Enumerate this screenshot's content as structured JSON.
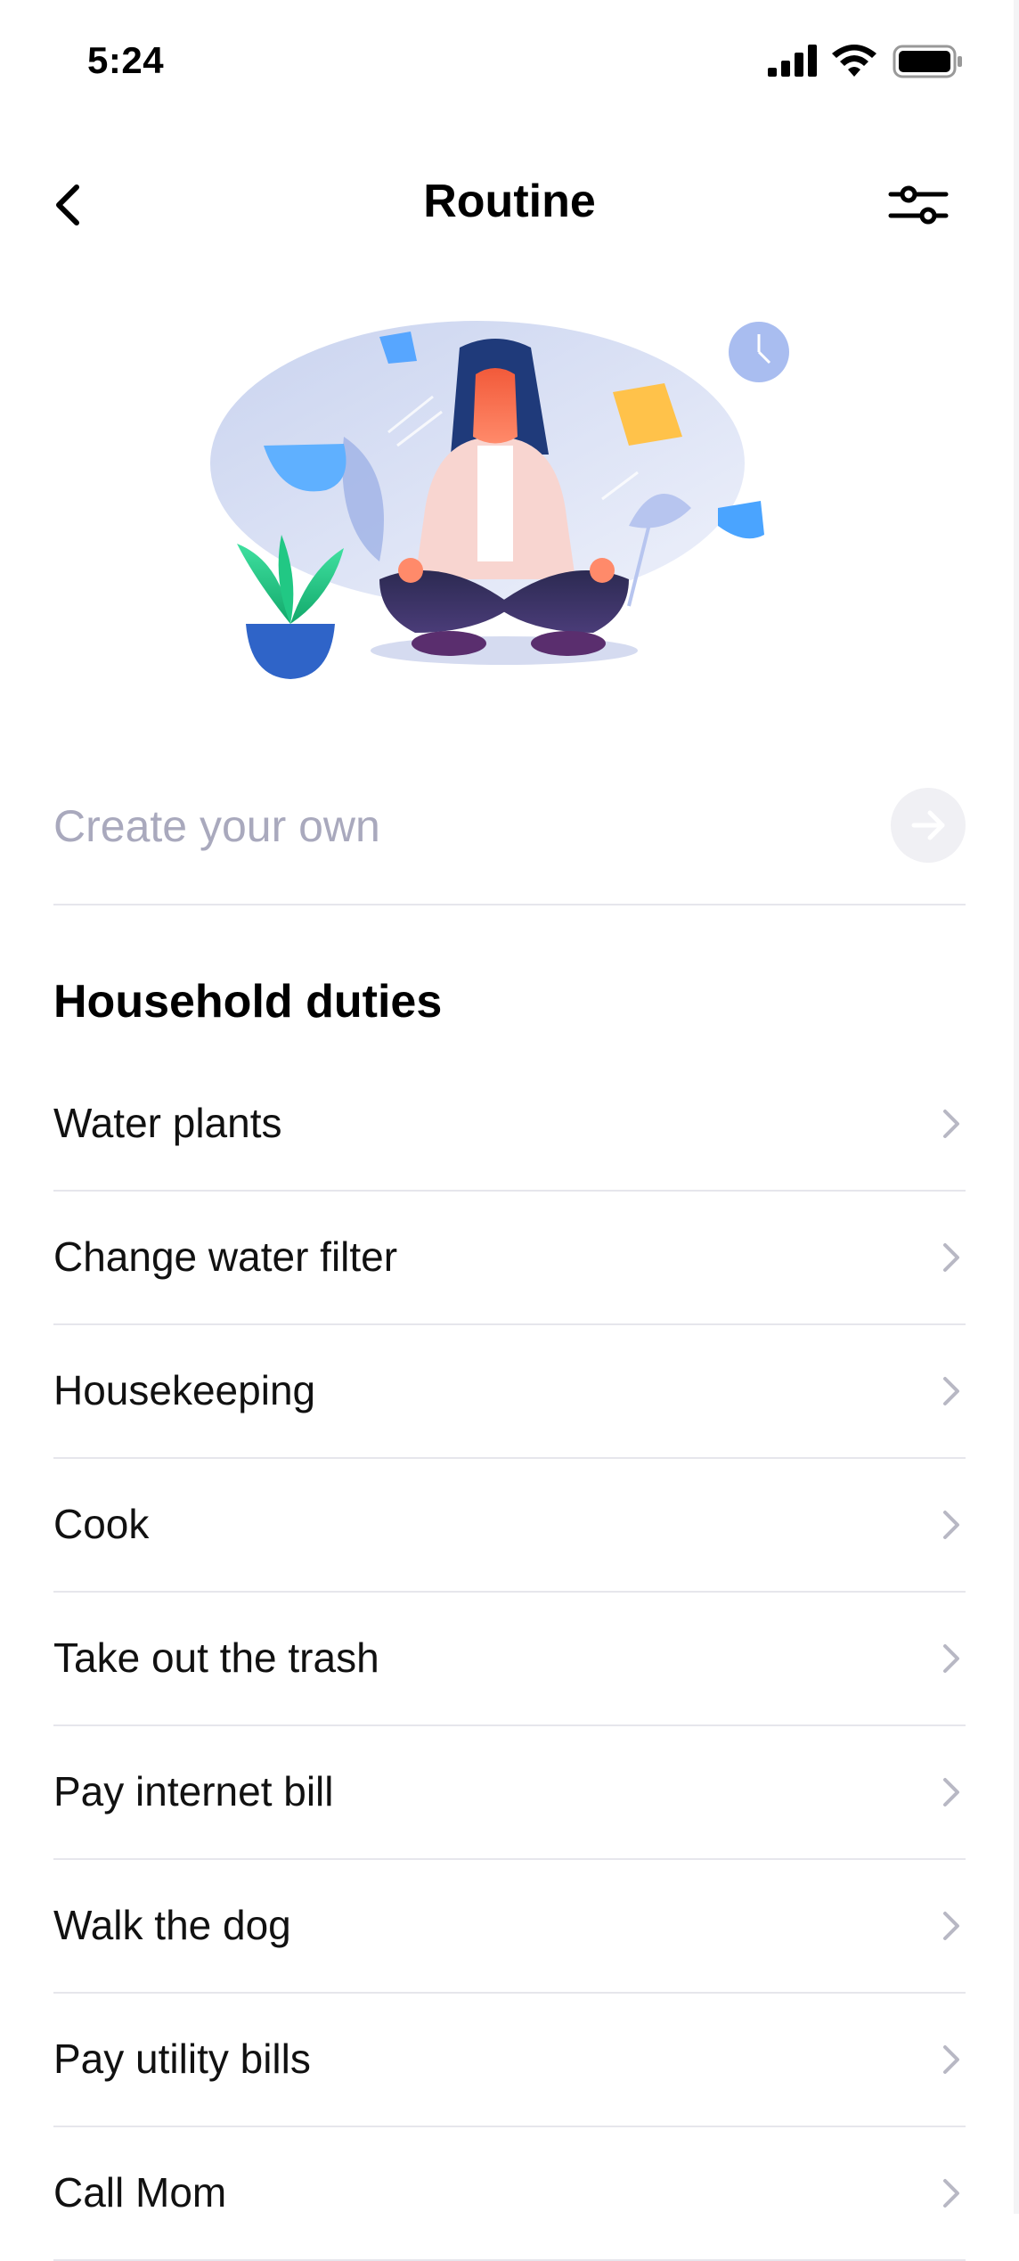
{
  "status_bar": {
    "time": "5:24",
    "icons": [
      "cellular-signal-icon",
      "wifi-icon",
      "battery-icon"
    ]
  },
  "nav": {
    "title": "Routine",
    "back_icon": "chevron-left-icon",
    "filter_icon": "sliders-icon"
  },
  "hero": {
    "illustration": "meditating-woman-illustration"
  },
  "create": {
    "placeholder": "Create your own",
    "button_icon": "arrow-right-icon"
  },
  "section": {
    "title": "Household duties",
    "items": [
      {
        "label": "Water plants"
      },
      {
        "label": "Change water filter"
      },
      {
        "label": "Housekeeping"
      },
      {
        "label": "Cook"
      },
      {
        "label": "Take out the trash"
      },
      {
        "label": "Pay internet bill"
      },
      {
        "label": "Walk the dog"
      },
      {
        "label": "Pay utility bills"
      },
      {
        "label": "Call Mom"
      }
    ]
  },
  "colors": {
    "accent_blue": "#2f8df5",
    "placeholder_gray": "#a9a9bd",
    "divider": "#e6e6ec",
    "chevron_gray": "#b8b8c4"
  }
}
